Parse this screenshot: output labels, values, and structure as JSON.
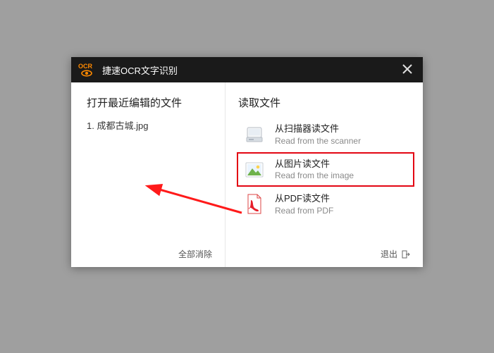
{
  "titlebar": {
    "logo_text": "OCR",
    "title": "捷速OCR文字识别"
  },
  "left": {
    "heading": "打开最近编辑的文件",
    "items": [
      {
        "index": "1.",
        "name": "成都古城.jpg"
      }
    ],
    "clear_all": "全部消除"
  },
  "right": {
    "heading": "读取文件",
    "options": [
      {
        "icon": "scanner-icon",
        "cn": "从扫描器读文件",
        "en": "Read from the scanner",
        "highlight": false
      },
      {
        "icon": "image-icon",
        "cn": "从图片读文件",
        "en": "Read from the image",
        "highlight": true
      },
      {
        "icon": "pdf-icon",
        "cn": "从PDF读文件",
        "en": "Read from PDF",
        "highlight": false
      }
    ],
    "exit": "退出"
  }
}
